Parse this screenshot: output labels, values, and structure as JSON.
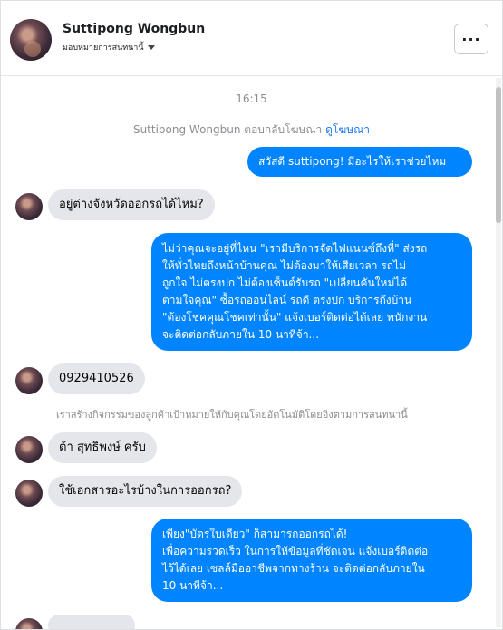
{
  "header": {
    "name": "Suttipong Wongbun",
    "subtitle": "มอบหมายการสนทนานี้",
    "more_label": "···"
  },
  "conversation": {
    "timestamp": "16:15",
    "ad_notice_prefix": "Suttipong Wongbun ตอบกลับโฆษณา",
    "ad_notice_link": "ดูโฆษณา",
    "messages": [
      {
        "from": "page",
        "lines": [
          "สวัสดี suttipong! มีอะไรให้เราช่วยไหม"
        ]
      },
      {
        "from": "user",
        "text": "อยู่ต่างจังหวัดออกรถได้ไหม?"
      },
      {
        "from": "page",
        "lines": [
          "ไม่ว่าคุณจะอยู่ที่ไหน \"เรามีบริการจัดไฟแนนซ์ถึงที่\"  ส่งรถ",
          "ให้ทั่วไทยถึงหน้าบ้านคุณ ไม่ต้องมาให้เสียเวลา รถไม่",
          "ถูกใจ ไม่ตรงปก ไม่ต้องเซ็นต์รับรถ \"เปลี่ยนคันใหม่ได้",
          "ตามใจคุณ\" ซื้อรถออนไลน์ รถดี ตรงปก บริการถึงบ้าน",
          "\"ต้องโชคคุณโชคเท่านั้น\" แจ้งเบอร์ติดต่อได้เลย พนักงาน",
          "จะติดต่อกลับภายใน 10 นาทีจ้า..."
        ]
      },
      {
        "from": "user",
        "text": "0929410526"
      },
      {
        "from": "system",
        "text": "เราสร้างกิจกรรมของลูกค้าเป้าหมายให้กับคุณโดยอัตโนมัติโดยอิงตามการสนทนานี้"
      },
      {
        "from": "user",
        "text": "ต้า สุทธิพงษ์ ครับ"
      },
      {
        "from": "user",
        "text": "ใช้เอกสารอะไรบ้างในการออกรถ?"
      },
      {
        "from": "page",
        "lines": [
          "เพียง\"บัตรใบเดียว\" ก็สามารถออกรถได้!",
          "เพื่อความรวดเร็ว ในการให้ข้อมูลที่ชัดเจน แจ้งเบอร์ติดต่อ",
          "ไว้ได้เลย เซลล์มืออาชีพจากทางร้าน จะติดต่อกลับภายใน",
          "10 นาทีจ้า..."
        ]
      }
    ]
  }
}
